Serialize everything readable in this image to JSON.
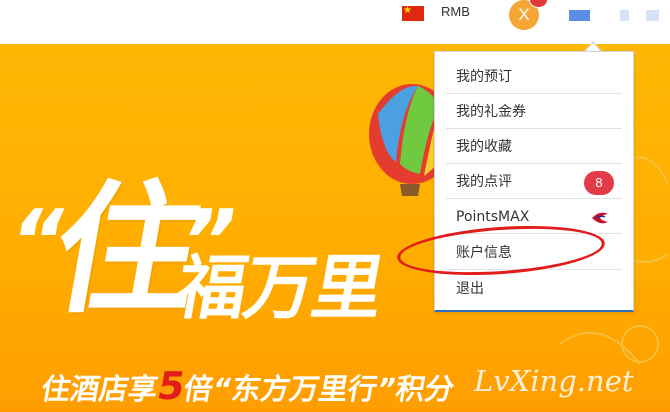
{
  "header": {
    "currency": "RMB",
    "avatar_letter": "X",
    "flag_icon": "china-flag"
  },
  "banner": {
    "quote_open": "“",
    "headline_char": "住",
    "quote_close": "”",
    "headline_rest": "福万里",
    "subline_before": "住酒店享",
    "subline_number": "5",
    "subline_after": "倍“东方万里行”积分",
    "watermark": "LvXing.net"
  },
  "menu": {
    "items": [
      {
        "label": "我的预订"
      },
      {
        "label": "我的礼金券"
      },
      {
        "label": "我的收藏"
      },
      {
        "label": "我的点评",
        "badge": "8"
      },
      {
        "label": "PointsMAX",
        "icon": "china-eastern-logo-icon"
      },
      {
        "label": "账户信息"
      },
      {
        "label": "退出"
      }
    ]
  },
  "colors": {
    "banner": "#ffb200",
    "badge": "#e23a47",
    "highlight": "#e21b1b",
    "avatar": "#f4a533"
  }
}
